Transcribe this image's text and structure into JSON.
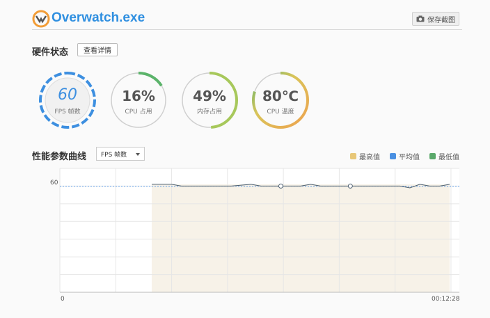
{
  "header": {
    "title": "Overwatch.exe",
    "screenshot_label": "保存截图"
  },
  "hardware": {
    "title": "硬件状态",
    "details_label": "查看详情",
    "gauges": [
      {
        "value": "60",
        "label": "FPS 帧数",
        "fraction": 1.0,
        "color": "#3d8fe0"
      },
      {
        "value": "16%",
        "label": "CPU 占用",
        "fraction": 0.16,
        "color": "#5bb36a"
      },
      {
        "value": "49%",
        "label": "内存占用",
        "fraction": 0.49,
        "color": "#a7c85b"
      },
      {
        "value": "80℃",
        "label": "CPU 温度",
        "fraction": 0.8,
        "color": "#d9c45a"
      }
    ]
  },
  "performance": {
    "title": "性能参数曲线",
    "metric_select": "FPS 帧数",
    "legend": [
      {
        "name": "最高值",
        "color": "#e8c778"
      },
      {
        "name": "平均值",
        "color": "#4a90e2"
      },
      {
        "name": "最低值",
        "color": "#5aa86a"
      }
    ]
  },
  "chart_data": {
    "type": "line",
    "xlabel": "",
    "ylabel": "",
    "x_start_label": "0",
    "x_end_label": "00:12:28",
    "y_reference": 60,
    "y_reference_label": "60",
    "ylim": [
      0,
      70
    ],
    "series": [
      {
        "values": [
          61,
          61,
          61,
          60,
          60,
          60,
          60,
          60,
          60,
          60.5,
          61,
          60,
          60,
          60,
          60,
          60,
          61,
          60,
          60,
          60,
          60,
          60,
          60,
          60,
          60,
          60,
          59,
          61,
          60,
          60,
          61
        ]
      }
    ],
    "markers": [
      13,
      20
    ],
    "shaded_start_index": 0
  }
}
